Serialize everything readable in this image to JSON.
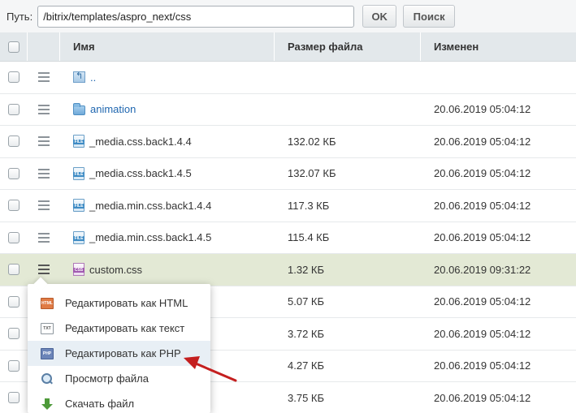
{
  "pathbar": {
    "label": "Путь:",
    "path_value": "/bitrix/templates/aspro_next/css",
    "ok_label": "OK",
    "search_label": "Поиск"
  },
  "table": {
    "headers": {
      "name": "Имя",
      "size": "Размер файла",
      "modified": "Изменен"
    },
    "rows": [
      {
        "name": "..",
        "size": "",
        "date": "",
        "icon": "folder-up-icon"
      },
      {
        "name": "animation",
        "size": "",
        "date": "20.06.2019 05:04:12",
        "icon": "folder-icon"
      },
      {
        "name": "_media.css.back1.4.4",
        "size": "132.02 КБ",
        "date": "20.06.2019 05:04:12",
        "icon": "file-icon"
      },
      {
        "name": "_media.css.back1.4.5",
        "size": "132.07 КБ",
        "date": "20.06.2019 05:04:12",
        "icon": "file-icon"
      },
      {
        "name": "_media.min.css.back1.4.4",
        "size": "117.3 КБ",
        "date": "20.06.2019 05:04:12",
        "icon": "file-icon"
      },
      {
        "name": "_media.min.css.back1.4.5",
        "size": "115.4 КБ",
        "date": "20.06.2019 05:04:12",
        "icon": "file-icon"
      },
      {
        "name": "custom.css",
        "size": "1.32 КБ",
        "date": "20.06.2019 09:31:22",
        "icon": "css-file-icon"
      },
      {
        "name": "",
        "size": "5.07 КБ",
        "date": "20.06.2019 05:04:12",
        "icon": ""
      },
      {
        "name": "",
        "size": "3.72 КБ",
        "date": "20.06.2019 05:04:12",
        "icon": ""
      },
      {
        "name": "",
        "size": "4.27 КБ",
        "date": "20.06.2019 05:04:12",
        "icon": ""
      },
      {
        "name": "",
        "size": "3.75 КБ",
        "date": "20.06.2019 05:04:12",
        "icon": ""
      }
    ]
  },
  "context_menu": {
    "items": [
      {
        "label": "Редактировать как HTML",
        "icon": "html-file-icon",
        "icon_text": "HTML"
      },
      {
        "label": "Редактировать как текст",
        "icon": "txt-file-icon",
        "icon_text": "TXT"
      },
      {
        "label": "Редактировать как PHP",
        "icon": "php-file-icon",
        "icon_text": "PHP"
      },
      {
        "label": "Просмотр файла",
        "icon": "magnifier-icon",
        "icon_text": ""
      },
      {
        "label": "Скачать файл",
        "icon": "download-icon",
        "icon_text": ""
      }
    ]
  },
  "colors": {
    "link": "#2067b0",
    "header_bg": "#e3e8eb",
    "highlight_row": "#e3e9d5",
    "arrow": "#c41f1f"
  }
}
